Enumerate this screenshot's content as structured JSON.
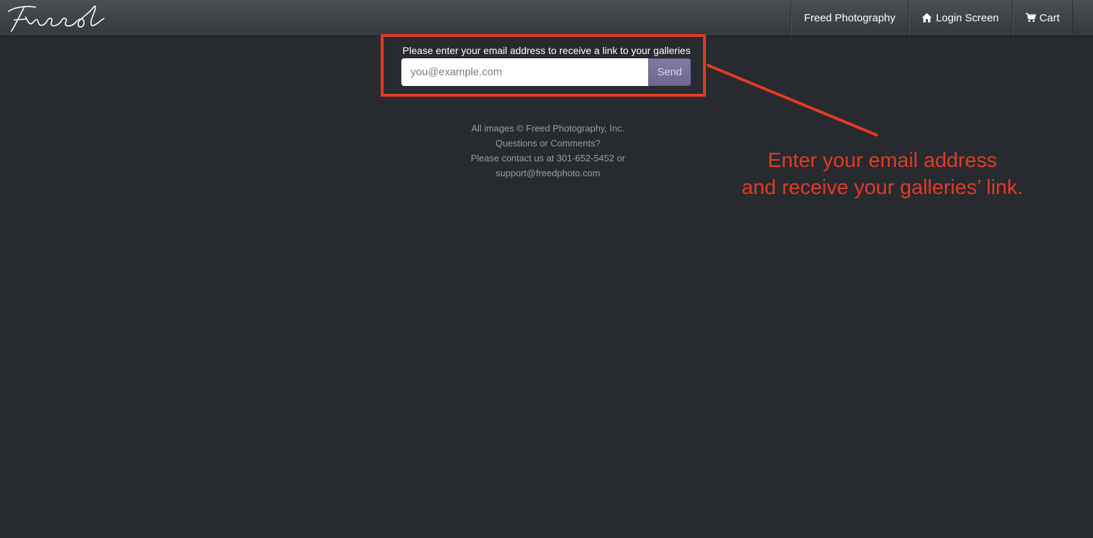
{
  "brand": {
    "logo_text": "Freed"
  },
  "nav": {
    "items": [
      {
        "label": "Freed Photography",
        "icon": ""
      },
      {
        "label": "Login Screen",
        "icon": "home-icon"
      },
      {
        "label": "Cart",
        "icon": "cart-icon"
      }
    ]
  },
  "form": {
    "prompt": "Please enter your email address to receive a link to your galleries",
    "email_placeholder": "you@example.com",
    "email_value": "",
    "send_label": "Send"
  },
  "footer": {
    "copyright": "All images ©  Freed Photography, Inc.",
    "questions": "Questions or Comments?",
    "contact": "Please contact us at 301-652-5452 or",
    "email": "support@freedphoto.com"
  },
  "annotation": {
    "line1": "Enter your email address",
    "line2": "and receive your galleries’ link.",
    "color": "#e23b23"
  }
}
